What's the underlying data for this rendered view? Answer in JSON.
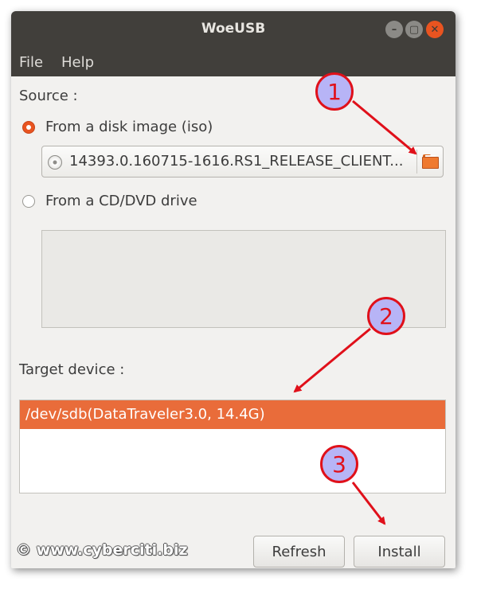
{
  "window": {
    "title": "WoeUSB",
    "controls": {
      "minimize": "–",
      "maximize": "▢",
      "close": "✕"
    }
  },
  "menu": [
    "File",
    "Help"
  ],
  "source": {
    "label": "Source :",
    "option_iso": "From a disk image (iso)",
    "iso_selected": true,
    "iso_file": "14393.0.160715-1616.RS1_RELEASE_CLIENT...",
    "option_cd": "From a CD/DVD drive",
    "cd_drives": []
  },
  "target": {
    "label": "Target device :",
    "devices": [
      "/dev/sdb(DataTraveler3.0, 14.4G)"
    ],
    "selected_index": 0
  },
  "buttons": {
    "refresh": "Refresh",
    "install": "Install"
  },
  "annotations": [
    "1",
    "2",
    "3"
  ],
  "watermark": "© www.cyberciti.biz",
  "colors": {
    "accent": "#e95420",
    "selection": "#e96c3a",
    "annotation_red": "#e0101a",
    "annotation_fill": "#b7b4f6",
    "titlebar": "#413f3b"
  }
}
